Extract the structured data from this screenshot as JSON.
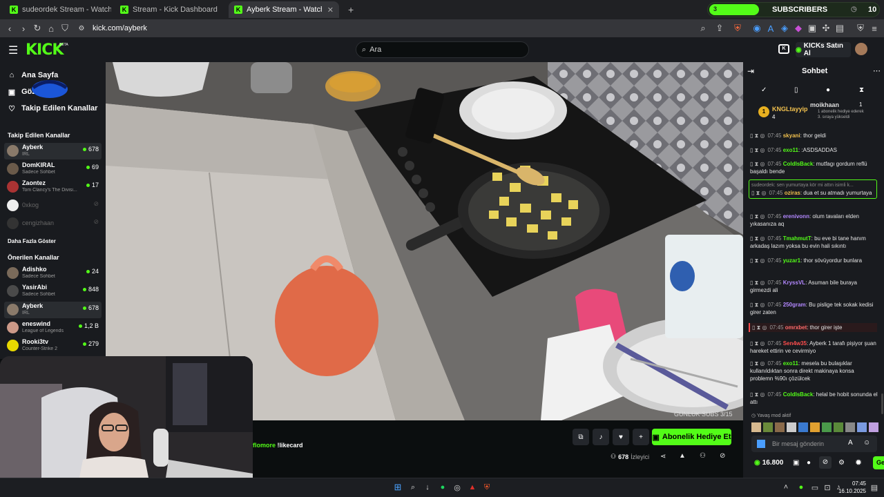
{
  "browser": {
    "tabs": [
      {
        "label": "sudeordek Stream - Watch Live on K"
      },
      {
        "label": "Stream - Kick Dashboard"
      },
      {
        "label": "Ayberk Stream - Watch Live o"
      }
    ],
    "url": "kick.com/ayberk",
    "subs_goal": {
      "left": "3",
      "label": "SUBSCRIBERS",
      "right": "10"
    }
  },
  "header": {
    "logo": "KICK",
    "logo_badge": "BETA",
    "search_placeholder": "Ara",
    "buy_label": "KICKs Satın Al"
  },
  "sidebar": {
    "nav": [
      {
        "label": "Ana Sayfa",
        "icon": "home-icon"
      },
      {
        "label": "Göz",
        "icon": "compass-icon"
      },
      {
        "label": "Takip Edilen Kanallar",
        "icon": "heart-icon"
      }
    ],
    "followed_title": "Takip Edilen Kanallar",
    "followed": [
      {
        "name": "Ayberk",
        "sub": "IRL",
        "viewers": "678",
        "live": true,
        "color": "#8a7a6a"
      },
      {
        "name": "DomKIRAL",
        "sub": "Sadece Sohbet",
        "viewers": "69",
        "live": true,
        "color": "#6a5a4a"
      },
      {
        "name": "Zaontez",
        "sub": "Tom Clancy's The Divisi...",
        "viewers": "17",
        "live": true,
        "color": "#a33"
      },
      {
        "name": "0xkog",
        "sub": "",
        "viewers": "",
        "live": false,
        "color": "#eee"
      },
      {
        "name": "cengizhaan",
        "sub": "",
        "viewers": "",
        "live": false,
        "color": "#333"
      }
    ],
    "more_label": "Daha Fazla Göster",
    "recommended_title": "Önerilen Kanallar",
    "recommended": [
      {
        "name": "Adishko",
        "sub": "Sadece Sohbet",
        "viewers": "24",
        "color": "#7a6a5a"
      },
      {
        "name": "YasirAbi",
        "sub": "Sadece Sohbet",
        "viewers": "848",
        "color": "#4a4a4a"
      },
      {
        "name": "Ayberk",
        "sub": "IRL",
        "viewers": "678",
        "color": "#8a7a6a"
      },
      {
        "name": "eneswind",
        "sub": "League of Legends",
        "viewers": "1,2 B",
        "color": "#c98"
      },
      {
        "name": "Rooki3tv",
        "sub": "Counter-Strike 2",
        "viewers": "279",
        "color": "#e8d800"
      }
    ]
  },
  "video": {
    "overlay_text": "GÜNLÜK SUBS 3/15"
  },
  "infobar": {
    "chat_preview_user": "flomore",
    "chat_preview_text": "!likecard",
    "gift_label": "Abonelik Hediye Et",
    "viewers": "678",
    "viewers_label": "İzleyici"
  },
  "chat": {
    "title": "Sohbet",
    "leaders": [
      {
        "name": "KNGLtayyip",
        "count": "4",
        "rank": "1"
      },
      {
        "name": "moikhaan",
        "count": "1",
        "note": "1 abonelik hediye ederek 3. sıraya yükseldi"
      }
    ],
    "messages": [
      {
        "time": "07:45",
        "user": "skyani",
        "color": "#f2c14e",
        "text": "thor geldi"
      },
      {
        "time": "07:45",
        "user": "exo11",
        "color": "#53fc18",
        "text": ":ASDSADDAS"
      },
      {
        "time": "07:45",
        "user": "ColdIsBack",
        "color": "#53fc18",
        "text": "mutfagı gordum reflü başaldı bende"
      },
      {
        "time": "07:45",
        "user": "oziras",
        "color": "#f2c14e",
        "text": "dua et su atmadı yumurtaya",
        "reply": "sudeordek: sen yumurtaya kör mi attın isimli k..."
      },
      {
        "time": "07:45",
        "user": "erenivonn",
        "color": "#b388ff",
        "text": "olum tavaları elden yıkasanıza aq"
      },
      {
        "time": "07:45",
        "user": "TmahmutT",
        "color": "#53fc18",
        "text": "bu eve bi tane hanım arkadaş lazım yoksa bu evin hali sıkıntı"
      },
      {
        "time": "07:45",
        "user": "yuzar1",
        "color": "#53fc18",
        "text": "thor sövüyordur bunlara"
      },
      {
        "time": "07:45",
        "user": "KryssVL",
        "color": "#b388ff",
        "text": "Asuman bile buraya girmezdi ali"
      },
      {
        "time": "07:45",
        "user": "250gram",
        "color": "#b388ff",
        "text": "Bu pislige tek sokak kedisi girer zaten"
      },
      {
        "time": "07:45",
        "user": "omrxbet",
        "color": "#ff6b6b",
        "text": "thor girer işte"
      },
      {
        "time": "07:45",
        "user": "Sen4w35",
        "color": "#ff4d4d",
        "text": "Ayberk 1 tarafı pişiyor şuan hareket ettirin ve cevirmiyo"
      },
      {
        "time": "07:45",
        "user": "exo11",
        "color": "#53fc18",
        "text": "mesela bu bulaşıklar kullanıldıktan sonra direkt makinaya konsa problemn %90ı çözülcek"
      },
      {
        "time": "07:45",
        "user": "ColdIsBack",
        "color": "#53fc18",
        "text": "helal be hobit sonunda el attı"
      }
    ],
    "slow_mode": "Yavaş mod aktif",
    "input_placeholder": "Bir mesaj gönderin",
    "balance": "16.800",
    "send_label": "Ge"
  },
  "taskbar": {
    "time": "07:45",
    "date": "16.10.2025"
  }
}
